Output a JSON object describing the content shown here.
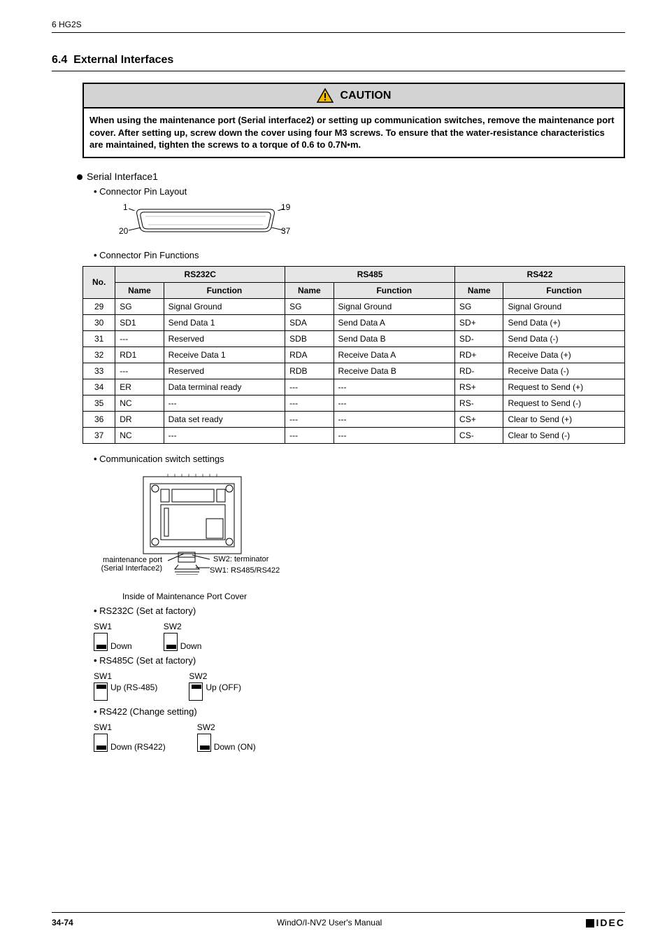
{
  "header": {
    "chapter": "6 HG2S"
  },
  "section": {
    "number": "6.4",
    "title": "External Interfaces"
  },
  "caution": {
    "label": "CAUTION",
    "text": "When using the maintenance port (Serial interface2) or setting up communication switches, remove the maintenance port cover. After setting up, screw down the cover using four M3 screws. To ensure that the water-resistance characteristics are maintained, tighten the screws to a torque of 0.6 to 0.7N•m."
  },
  "serial_interface": {
    "title": "Serial Interface1",
    "layout_label": "Connector Pin Layout",
    "functions_label": "Connector Pin Functions",
    "pins": {
      "tl": "1",
      "tr": "19",
      "bl": "20",
      "br": "37"
    }
  },
  "table": {
    "group_headers": [
      "RS232C",
      "RS485",
      "RS422"
    ],
    "sub_headers": [
      "No.",
      "Name",
      "Function",
      "Name",
      "Function",
      "Name",
      "Function"
    ],
    "rows": [
      [
        "29",
        "SG",
        "Signal Ground",
        "SG",
        "Signal Ground",
        "SG",
        "Signal Ground"
      ],
      [
        "30",
        "SD1",
        "Send Data 1",
        "SDA",
        "Send Data A",
        "SD+",
        "Send Data (+)"
      ],
      [
        "31",
        "---",
        "Reserved",
        "SDB",
        "Send Data B",
        "SD-",
        "Send Data (-)"
      ],
      [
        "32",
        "RD1",
        "Receive Data 1",
        "RDA",
        "Receive Data A",
        "RD+",
        "Receive Data (+)"
      ],
      [
        "33",
        "---",
        "Reserved",
        "RDB",
        "Receive Data B",
        "RD-",
        "Receive Data (-)"
      ],
      [
        "34",
        "ER",
        "Data terminal ready",
        "---",
        "---",
        "RS+",
        "Request to Send (+)"
      ],
      [
        "35",
        "NC",
        "---",
        "---",
        "---",
        "RS-",
        "Request to Send (-)"
      ],
      [
        "36",
        "DR",
        "Data set ready",
        "---",
        "---",
        "CS+",
        "Clear to Send (+)"
      ],
      [
        "37",
        "NC",
        "---",
        "---",
        "---",
        "CS-",
        "Clear to Send (-)"
      ]
    ]
  },
  "comm_switch": {
    "heading": "Communication switch settings",
    "labels": {
      "maint1": "maintenance port",
      "maint2": "(Serial Interface2)",
      "sw2": "SW2: terminator",
      "sw1": "SW1: RS485/RS422"
    },
    "caption": "Inside of Maintenance Port Cover"
  },
  "settings": [
    {
      "label": "RS232C (Set at factory)",
      "sw1": {
        "name": "SW1",
        "pos": "down",
        "text": "Down"
      },
      "sw2": {
        "name": "SW2",
        "pos": "down",
        "text": "Down"
      }
    },
    {
      "label": "RS485C (Set at factory)",
      "sw1": {
        "name": "SW1",
        "pos": "up",
        "text": "Up (RS-485)"
      },
      "sw2": {
        "name": "SW2",
        "pos": "up",
        "text": "Up (OFF)"
      }
    },
    {
      "label": "RS422 (Change setting)",
      "sw1": {
        "name": "SW1",
        "pos": "down",
        "text": "Down (RS422)"
      },
      "sw2": {
        "name": "SW2",
        "pos": "down",
        "text": "Down (ON)"
      }
    }
  ],
  "footer": {
    "page": "34-74",
    "manual": "WindO/I-NV2 User's Manual",
    "logo": "IDEC"
  }
}
